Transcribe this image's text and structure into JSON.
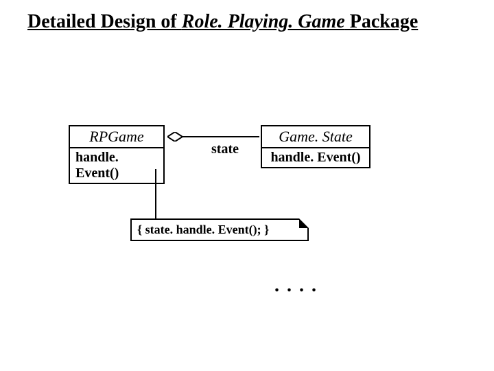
{
  "title": {
    "prefix": "Detailed Design of ",
    "italic": "Role. Playing. Game",
    "suffix": " Package"
  },
  "classes": {
    "rpgame": {
      "name": "RPGame",
      "method": "handle. Event()"
    },
    "gamestate": {
      "name": "Game. State",
      "method": "handle. Event()"
    }
  },
  "association": {
    "role": "state"
  },
  "note": {
    "body": "{  state. handle. Event(); }"
  },
  "ellipsis": ". . . ."
}
